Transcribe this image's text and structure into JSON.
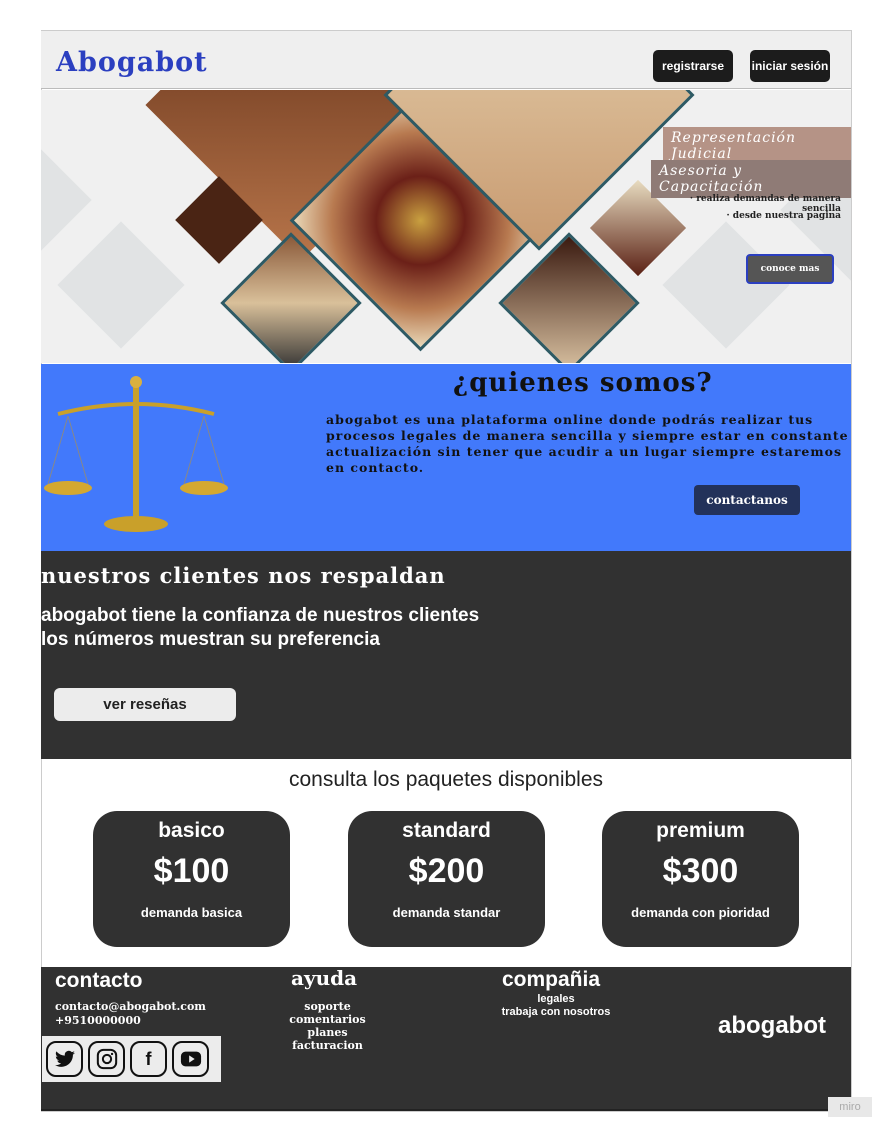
{
  "header": {
    "logo": "Abogabot",
    "register": "registrarse",
    "login": "iniciar sesión"
  },
  "hero": {
    "tag1": "Representación Judicial",
    "tag2": "Asesoria y Capacitación",
    "bullet1": "· realiza demandas de manera sencilla",
    "bullet2": "· desde nuestra pagina",
    "cta": "conoce mas"
  },
  "about": {
    "title": "¿quienes somos?",
    "text": "abogabot es una plataforma online donde podrás realizar tus procesos legales de manera sencilla y siempre estar en constante actualización sin tener que acudir a un lugar siempre estaremos en contacto.",
    "cta": "contactanos"
  },
  "clients": {
    "title": "nuestros clientes nos respaldan",
    "line1": "abogabot tiene la confianza de nuestros clientes",
    "line2": "los números muestran su preferencia",
    "cta": "ver reseñas"
  },
  "packages": {
    "title": "consulta los paquetes disponibles",
    "items": [
      {
        "name": "basico",
        "price": "$100",
        "desc": "demanda basica"
      },
      {
        "name": "standard",
        "price": "$200",
        "desc": "demanda standar"
      },
      {
        "name": "premium",
        "price": "$300",
        "desc": "demanda con pioridad"
      }
    ]
  },
  "footer": {
    "contact_title": "contacto",
    "email": "contacto@abogabot.com",
    "phone": "+9510000000",
    "help_title": "ayuda",
    "help": [
      "soporte",
      "comentarios",
      "planes",
      "facturacion"
    ],
    "company_title": "compañia",
    "company": [
      "legales",
      "trabaja con nosotros"
    ],
    "brand": "abogabot",
    "social": [
      "twitter-icon",
      "instagram-icon",
      "facebook-icon",
      "youtube-icon"
    ]
  },
  "watermark": "miro"
}
